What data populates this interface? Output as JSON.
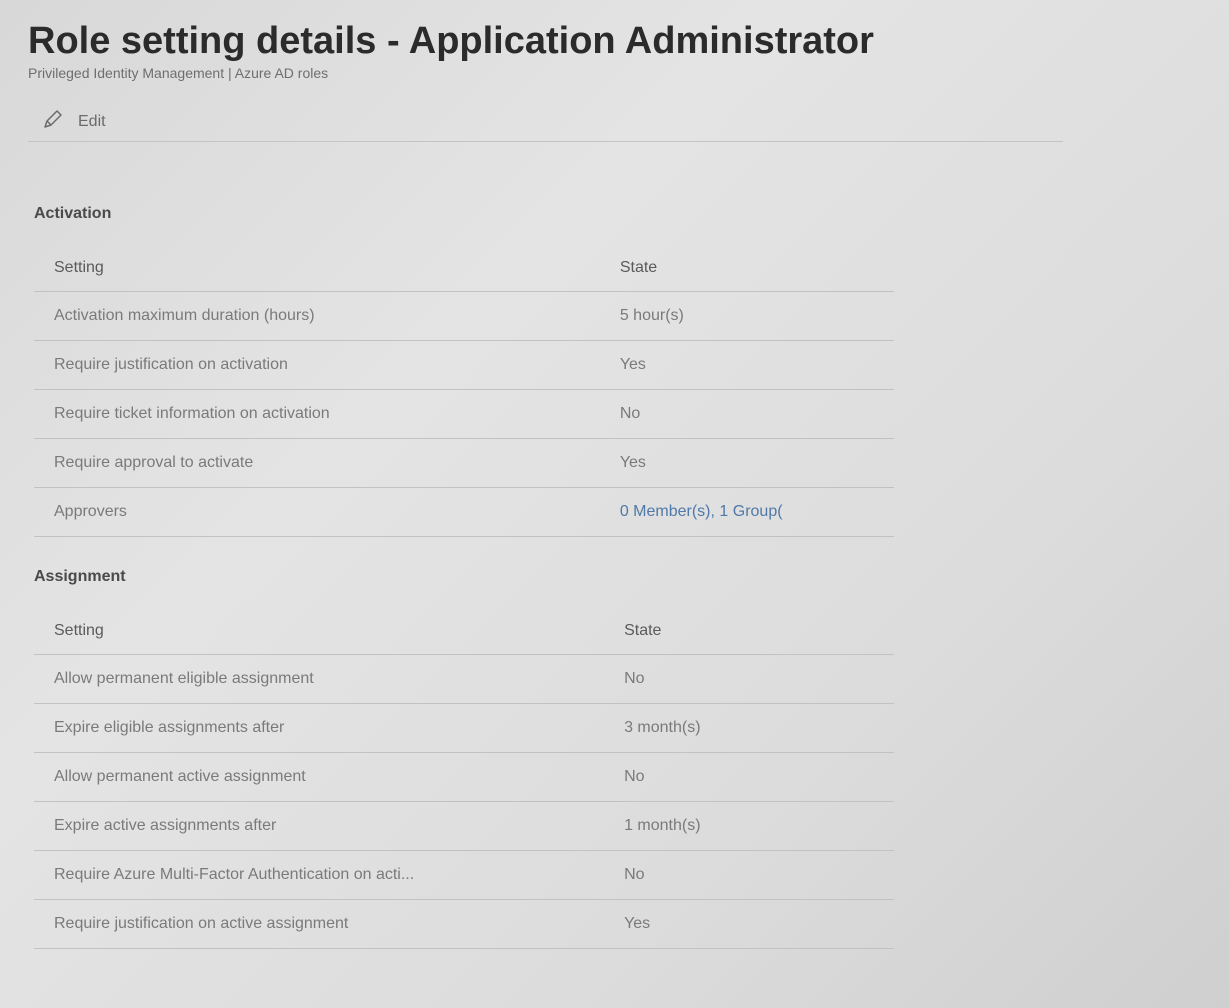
{
  "blade": {
    "title": "Role setting details - Application Administrator",
    "subtitle": "Privileged Identity Management | Azure AD roles"
  },
  "toolbar": {
    "edit_icon": "pencil-icon",
    "edit_label": "Edit"
  },
  "activation": {
    "section_title": "Activation",
    "columns": [
      "Setting",
      "State"
    ],
    "rows": [
      {
        "setting": "Activation maximum duration (hours)",
        "state": "5 hour(s)"
      },
      {
        "setting": "Require justification on activation",
        "state": "Yes"
      },
      {
        "setting": "Require ticket information on activation",
        "state": "No"
      },
      {
        "setting": "Require approval to activate",
        "state": "Yes"
      },
      {
        "setting": "Approvers",
        "state": "0 Member(s), 1 Group("
      }
    ]
  },
  "assignment": {
    "section_title": "Assignment",
    "columns": [
      "Setting",
      "State"
    ],
    "rows": [
      {
        "setting": "Allow permanent eligible assignment",
        "state": "No"
      },
      {
        "setting": "Expire eligible assignments after",
        "state": "3 month(s)"
      },
      {
        "setting": "Allow permanent active assignment",
        "state": "No"
      },
      {
        "setting": "Expire active assignments after",
        "state": "1 month(s)"
      },
      {
        "setting": "Require Azure Multi-Factor Authentication on acti...",
        "state": "No"
      },
      {
        "setting": "Require justification on active assignment",
        "state": "Yes"
      }
    ]
  },
  "colors": {
    "link": "#4f79a8",
    "title": "#2b2b2b"
  }
}
